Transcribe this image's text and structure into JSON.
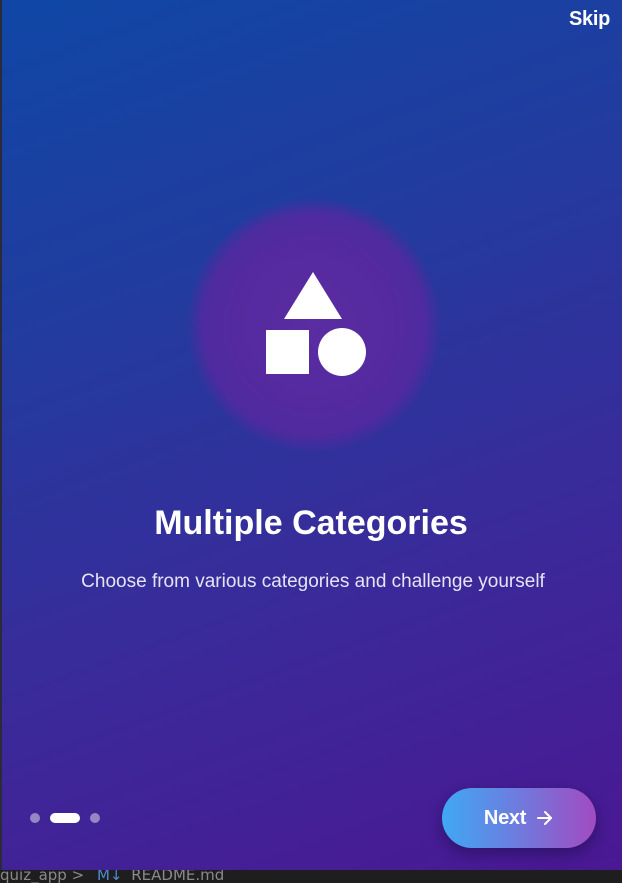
{
  "skip_label": "Skip",
  "slide": {
    "icon": "shapes-icon",
    "title": "Multiple Categories",
    "subtitle": "Choose from various categories and challenge yourself"
  },
  "pagination": {
    "total": 3,
    "current": 2
  },
  "next_button": {
    "label": "Next",
    "icon": "arrow-right-icon"
  },
  "status_bar": {
    "path": "quiz_app",
    "separator": ">",
    "file_icon": "M↓",
    "file_name": "README.md"
  },
  "colors": {
    "background_start": "#0f47a6",
    "background_end": "#4a1893",
    "glow": "#55299f",
    "button_start": "#3fa8f4",
    "button_end": "#a24bc1",
    "text": "#ffffff"
  }
}
